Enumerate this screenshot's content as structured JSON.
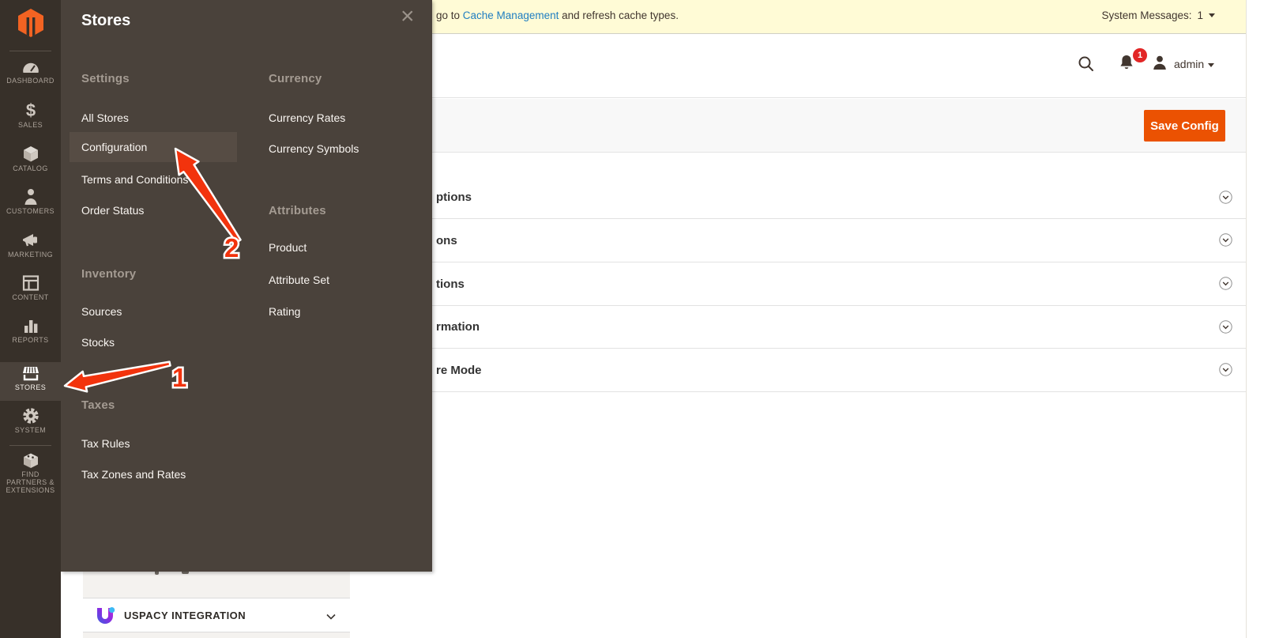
{
  "message_bar": {
    "prefix": "go to ",
    "link": "Cache Management",
    "suffix": " and refresh cache types.",
    "system_messages_label": "System Messages:",
    "system_messages_count": "1"
  },
  "header": {
    "username": "admin",
    "notification_badge": "1",
    "icons": [
      "search-icon",
      "notifications-bell-icon",
      "user-avatar-icon"
    ]
  },
  "toolbar": {
    "save_button": "Save Config"
  },
  "sidebar": {
    "items": [
      {
        "label": "DASHBOARD",
        "icon": "dashboard-icon"
      },
      {
        "label": "SALES",
        "icon": "sales-icon"
      },
      {
        "label": "CATALOG",
        "icon": "catalog-icon"
      },
      {
        "label": "CUSTOMERS",
        "icon": "customers-icon"
      },
      {
        "label": "MARKETING",
        "icon": "marketing-icon"
      },
      {
        "label": "CONTENT",
        "icon": "content-icon"
      },
      {
        "label": "REPORTS",
        "icon": "reports-icon"
      },
      {
        "label": "STORES",
        "icon": "stores-icon",
        "active": true
      },
      {
        "label": "SYSTEM",
        "icon": "system-icon"
      },
      {
        "label": "FIND PARTNERS & EXTENSIONS",
        "icon": "extensions-icon"
      }
    ]
  },
  "stores_menu": {
    "title": "Stores",
    "close_icon": "×",
    "column1": {
      "settings": {
        "heading": "Settings",
        "items": [
          "All Stores",
          "Configuration",
          "Terms and Conditions",
          "Order Status"
        ],
        "highlighted": "Configuration"
      },
      "inventory": {
        "heading": "Inventory",
        "items": [
          "Sources",
          "Stocks"
        ]
      },
      "taxes": {
        "heading": "Taxes",
        "items": [
          "Tax Rules",
          "Tax Zones and Rates"
        ]
      }
    },
    "column2": {
      "currency": {
        "heading": "Currency",
        "items": [
          "Currency Rates",
          "Currency Symbols"
        ]
      },
      "attributes": {
        "heading": "Attributes",
        "items": [
          "Product",
          "Attribute Set",
          "Rating"
        ]
      }
    }
  },
  "content": {
    "sections": [
      {
        "visible_text": "ptions"
      },
      {
        "visible_text": "ons"
      },
      {
        "visible_text": "tions"
      },
      {
        "visible_text": "rmation"
      },
      {
        "visible_text": "re Mode"
      }
    ]
  },
  "config_nav": {
    "section_label": "USPACY INTEGRATION"
  },
  "annotations": {
    "step_1": "1",
    "step_2": "2"
  },
  "colors": {
    "accent_orange": "#eb5202",
    "magento_orange": "#f26322",
    "badge_red": "#e22626",
    "arrow_red": "#f2330d",
    "link_blue": "#1f7ec1",
    "notice_yellow": "#fffbd6",
    "sidebar_dark": "#373029",
    "flyout_dark": "#4a423b"
  }
}
